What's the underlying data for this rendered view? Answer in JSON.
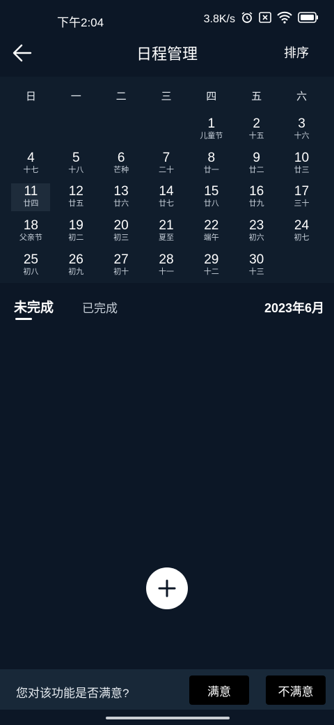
{
  "status_bar": {
    "time": "下午2:04",
    "network_speed": "3.8K/s",
    "icons": [
      "alarm-icon",
      "no-sim-icon",
      "wifi-icon",
      "battery-icon"
    ]
  },
  "header": {
    "title": "日程管理",
    "sort_label": "排序"
  },
  "calendar": {
    "weekdays": [
      "日",
      "一",
      "二",
      "三",
      "四",
      "五",
      "六"
    ],
    "days": [
      {
        "num": "",
        "lunar": ""
      },
      {
        "num": "",
        "lunar": ""
      },
      {
        "num": "",
        "lunar": ""
      },
      {
        "num": "",
        "lunar": ""
      },
      {
        "num": "1",
        "lunar": "儿童节"
      },
      {
        "num": "2",
        "lunar": "十五"
      },
      {
        "num": "3",
        "lunar": "十六"
      },
      {
        "num": "4",
        "lunar": "十七"
      },
      {
        "num": "5",
        "lunar": "十八"
      },
      {
        "num": "6",
        "lunar": "芒种"
      },
      {
        "num": "7",
        "lunar": "二十"
      },
      {
        "num": "8",
        "lunar": "廿一"
      },
      {
        "num": "9",
        "lunar": "廿二"
      },
      {
        "num": "10",
        "lunar": "廿三"
      },
      {
        "num": "11",
        "lunar": "廿四",
        "selected": true
      },
      {
        "num": "12",
        "lunar": "廿五"
      },
      {
        "num": "13",
        "lunar": "廿六"
      },
      {
        "num": "14",
        "lunar": "廿七"
      },
      {
        "num": "15",
        "lunar": "廿八"
      },
      {
        "num": "16",
        "lunar": "廿九"
      },
      {
        "num": "17",
        "lunar": "三十"
      },
      {
        "num": "18",
        "lunar": "父亲节"
      },
      {
        "num": "19",
        "lunar": "初二"
      },
      {
        "num": "20",
        "lunar": "初三"
      },
      {
        "num": "21",
        "lunar": "夏至"
      },
      {
        "num": "22",
        "lunar": "端午"
      },
      {
        "num": "23",
        "lunar": "初六"
      },
      {
        "num": "24",
        "lunar": "初七"
      },
      {
        "num": "25",
        "lunar": "初八"
      },
      {
        "num": "26",
        "lunar": "初九"
      },
      {
        "num": "27",
        "lunar": "初十"
      },
      {
        "num": "28",
        "lunar": "十一"
      },
      {
        "num": "29",
        "lunar": "十二"
      },
      {
        "num": "30",
        "lunar": "十三"
      }
    ]
  },
  "tabs": {
    "incomplete": "未完成",
    "complete": "已完成",
    "month": "2023年6月"
  },
  "feedback": {
    "question": "您对该功能是否满意?",
    "satisfied": "满意",
    "unsatisfied": "不满意"
  }
}
